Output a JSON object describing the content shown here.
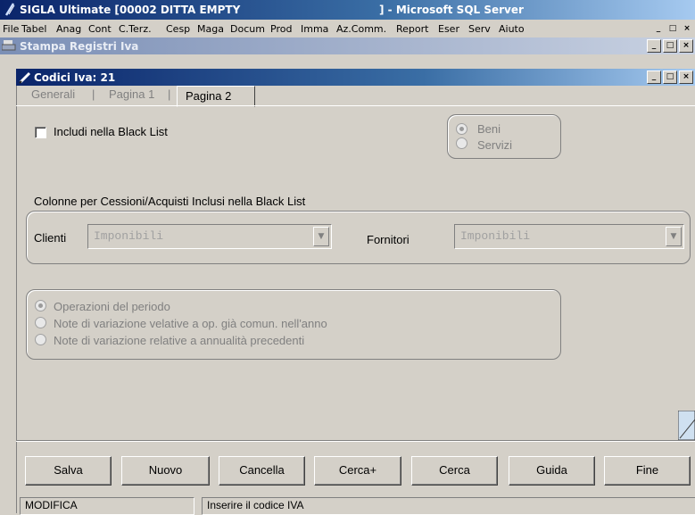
{
  "window": {
    "title_left": "SIGLA Ultimate [00002 DITTA EMPTY",
    "title_right": "] - Microsoft SQL Server"
  },
  "menu": [
    "File",
    "Tabel",
    "Anag",
    "Cont",
    "C.Terz.",
    "Cesp",
    "Maga",
    "Docum",
    "Prod",
    "Imma",
    "Az.Comm.",
    "Report",
    "Eser",
    "Serv",
    "Aiuto"
  ],
  "mdi_parent": {
    "title": "Stampa Registri Iva"
  },
  "child": {
    "title": "Codici Iva: 21"
  },
  "tabs": {
    "generali": "Generali",
    "pagina1": "Pagina 1",
    "pagina2": "Pagina 2",
    "sep": "|"
  },
  "blacklist": {
    "label": "Includi nella Black List",
    "checked": false
  },
  "beni_servizi": {
    "beni": "Beni",
    "servizi": "Servizi",
    "selected": "Beni"
  },
  "colonne": {
    "title": "Colonne per Cessioni/Acquisti Inclusi nella Black List",
    "clienti_label": "Clienti",
    "clienti_value": "Imponibili",
    "fornitori_label": "Fornitori",
    "fornitori_value": "Imponibili"
  },
  "operazioni": {
    "opt1": "Operazioni del periodo",
    "opt2": "Note di variazione velative a op. già comun. nell'anno",
    "opt3": "Note di variazione relative a annualità precedenti",
    "selected": "Operazioni del periodo"
  },
  "buttons": {
    "salva": "Salva",
    "nuovo": "Nuovo",
    "cancella": "Cancella",
    "cerca_plus": "Cerca+",
    "cerca": "Cerca",
    "guida": "Guida",
    "fine": "Fine"
  },
  "status": {
    "mode": "MODIFICA",
    "message": "Inserire il codice IVA"
  },
  "colors": {
    "titlebar": "#0a246a",
    "face": "#d4d0c8"
  }
}
